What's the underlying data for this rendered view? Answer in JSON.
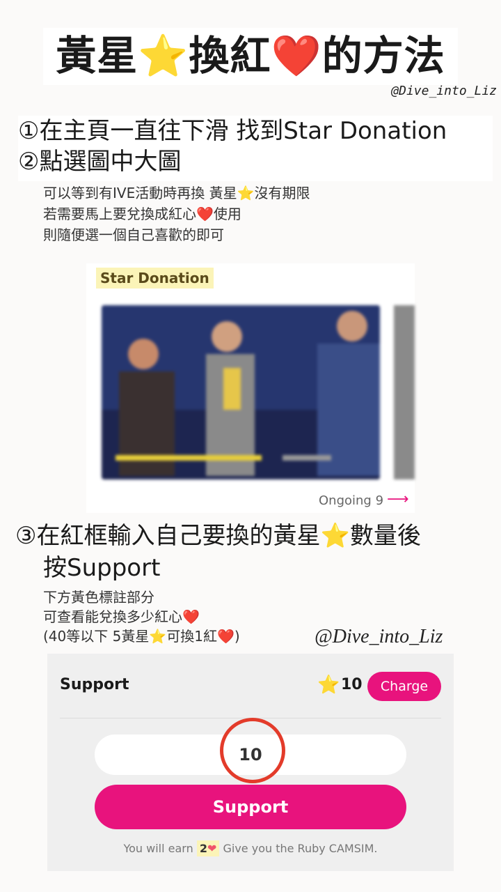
{
  "header": {
    "title_part1": "黃星",
    "title_star": "⭐",
    "title_part2": "換紅",
    "title_heart": "❤️",
    "title_part3": "的方法",
    "watermark": "@Dive_into_Liz"
  },
  "steps": {
    "step1": "①在主頁一直往下滑 找到Star Donation",
    "step2": "②點選圖中大圖",
    "note1_part1": "可以等到有IVE活動時再換 黃星",
    "note1_star": "⭐",
    "note1_part2": "沒有期限",
    "note2_part1": "若需要馬上要兌換成紅心",
    "note2_heart": "❤️",
    "note2_part2": "使用",
    "note3": "則隨便選一個自己喜歡的即可",
    "step3_part1": "③在紅框輸入自己要換的黃星",
    "step3_star": "⭐",
    "step3_part2": "數量後",
    "step3_line2": "按Support",
    "note4": "下方黃色標註部分",
    "note5_part1": "可查看能兌換多少紅心",
    "note5_heart": "❤️",
    "note6_part1": "(40等以下 5黃星",
    "note6_star": "⭐",
    "note6_part2": "可換1紅",
    "note6_heart": "❤️",
    "note6_part3": ")"
  },
  "star_donation": {
    "label": "Star Donation",
    "ongoing": "Ongoing 9",
    "arrow": "⟶"
  },
  "watermark2": "@Dive_into_Liz",
  "support": {
    "title": "Support",
    "star_icon": "⭐",
    "star_count": "10",
    "charge_label": "Charge",
    "input_value": "10",
    "button_label": "Support",
    "earn_prefix": "You will earn",
    "earn_value": "2",
    "earn_heart": "❤",
    "earn_suffix": "Give you the Ruby CAMSIM."
  },
  "colors": {
    "accent_pink": "#e8137d",
    "highlight_yellow": "#fbf4b8",
    "ring_red": "#e33b2a"
  }
}
